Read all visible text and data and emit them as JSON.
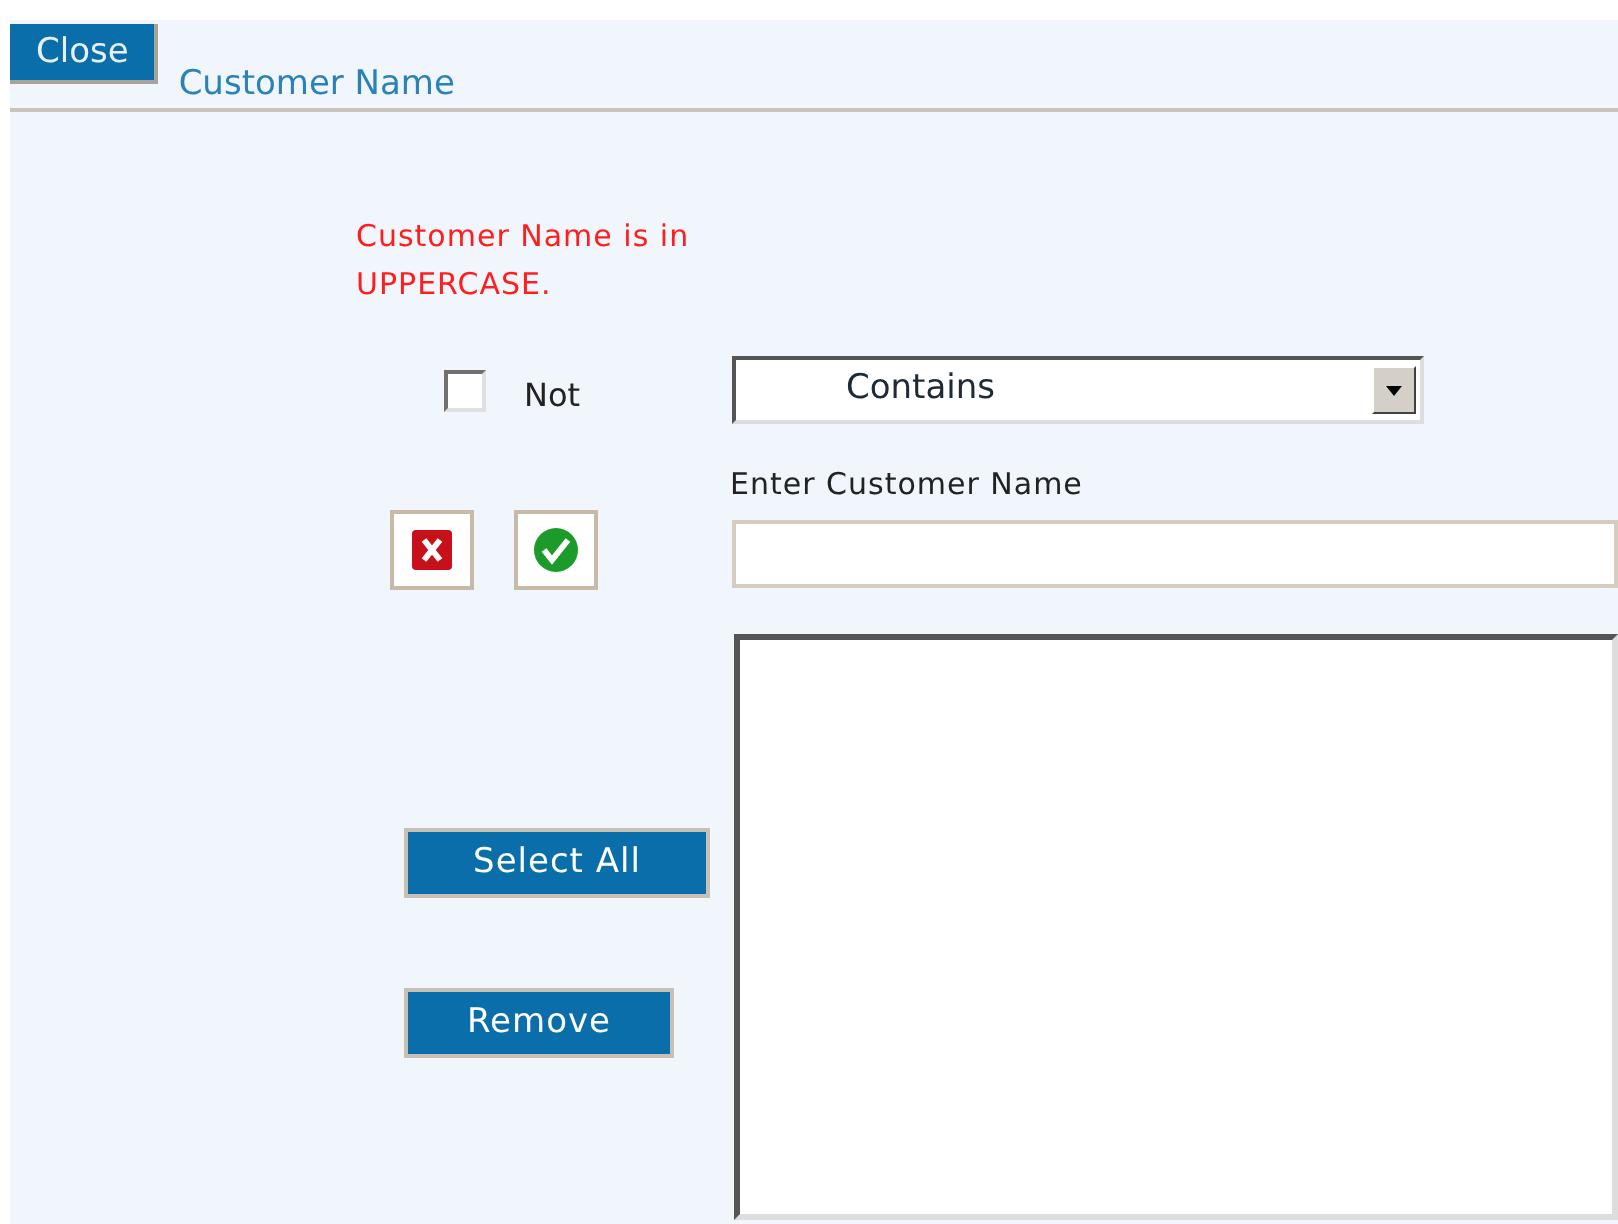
{
  "header": {
    "close_button": "Close",
    "title": "Customer Name"
  },
  "message": "Customer Name is in UPPERCASE.",
  "not_option": {
    "label": "Not",
    "checked": false
  },
  "operator": {
    "value": "Contains"
  },
  "name_field": {
    "label": "Enter Customer Name"
  },
  "buttons": [
    "Select All",
    "Remove"
  ]
}
